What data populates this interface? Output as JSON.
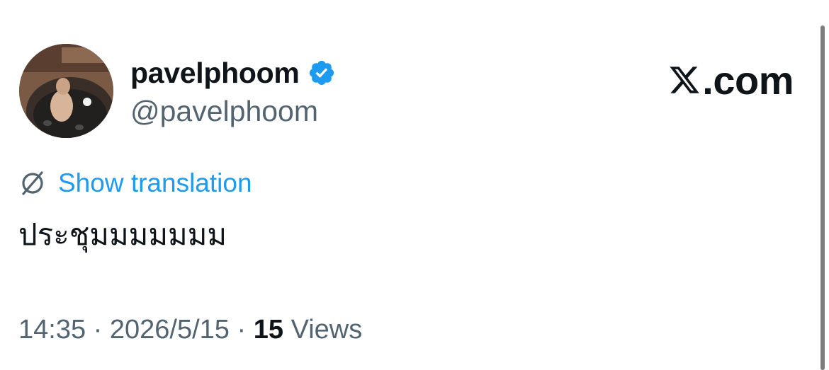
{
  "author": {
    "display_name": "pavelphoom",
    "handle": "@pavelphoom",
    "verified": true,
    "avatar_icon": "avatar-photo-person-in-hot-tub"
  },
  "brand": {
    "text": ".com",
    "logo_icon": "x-logo-icon"
  },
  "translation": {
    "label": "Show translation",
    "icon": "globe-icon"
  },
  "tweet": {
    "text": "ประชุมมมมมมม"
  },
  "meta": {
    "time": "14:35",
    "separator": " · ",
    "date": "2026/5/15",
    "views_count": "15",
    "views_label": "Views"
  },
  "colors": {
    "text_primary": "#0f1419",
    "text_secondary": "#536471",
    "accent": "#1d9bf0",
    "verified_badge": "#1d9bf0",
    "background": "#ffffff"
  }
}
